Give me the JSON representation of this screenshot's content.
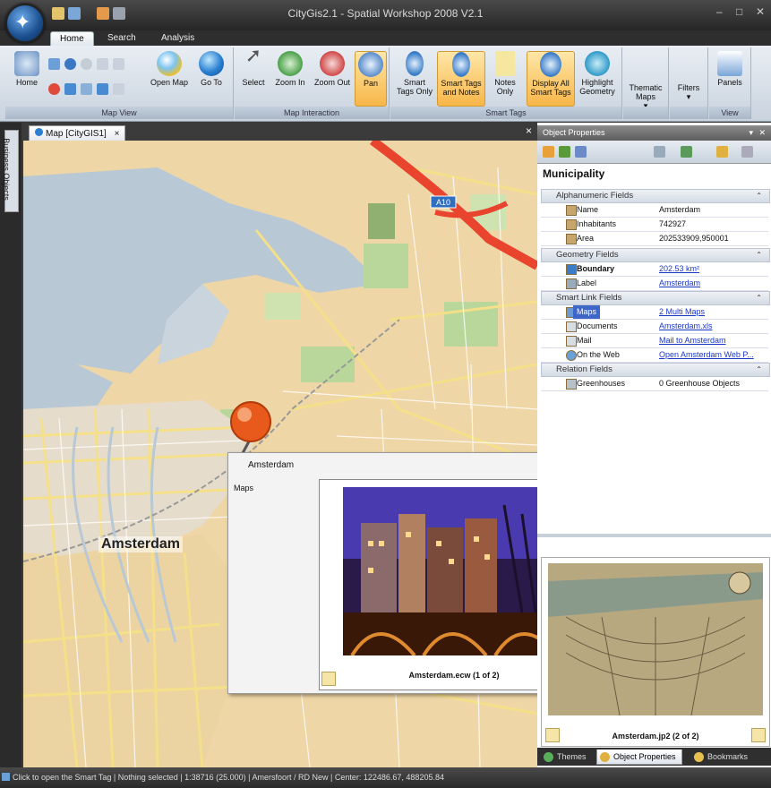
{
  "window": {
    "title": "CityGis2.1 - Spatial Workshop 2008 V2.1",
    "minimize": "–",
    "maximize": "□",
    "close": "✕"
  },
  "ribbon_tabs": [
    "Home",
    "Search",
    "Analysis"
  ],
  "ribbon": {
    "map_view": {
      "label": "Map View",
      "home": "Home",
      "open_map": "Open Map",
      "go_to": "Go To"
    },
    "map_interaction": {
      "label": "Map Interaction",
      "select": "Select",
      "zoom_in": "Zoom In",
      "zoom_out": "Zoom Out",
      "pan": "Pan"
    },
    "smart_tags": {
      "label": "Smart Tags",
      "smart_tags_only": "Smart Tags Only",
      "smart_tags_and_notes": "Smart Tags and Notes",
      "notes_only": "Notes Only",
      "display_all": "Display All Smart Tags",
      "highlight": "Highlight Geometry"
    },
    "thematic_maps": "Thematic Maps",
    "filters": "Filters",
    "view": {
      "label": "View",
      "panels": "Panels"
    }
  },
  "sidebar": {
    "business_objects": "Business Objects"
  },
  "document": {
    "tab_label": "Map [CityGIS1]",
    "close": "×",
    "pane_close": "×"
  },
  "map": {
    "city_label": "Amsterdam",
    "highway_label": "A10"
  },
  "popup": {
    "title": "Amsterdam",
    "maps_label": "Maps",
    "caption": "Amsterdam.ecw (1 of 2)"
  },
  "object_properties": {
    "panel_title": "Object Properties",
    "heading": "Municipality",
    "sections": [
      {
        "title": "Alphanumeric Fields",
        "rows": [
          {
            "key": "Name",
            "value": "Amsterdam",
            "link": false
          },
          {
            "key": "Inhabitants",
            "value": "742927",
            "link": false
          },
          {
            "key": "Area",
            "value": "202533909,950001",
            "link": false
          }
        ]
      },
      {
        "title": "Geometry Fields",
        "rows": [
          {
            "key": "Boundary",
            "value": "202.53 km²",
            "link": true
          },
          {
            "key": "Label",
            "value": "Amsterdam",
            "link": true
          }
        ]
      },
      {
        "title": "Smart Link Fields",
        "rows": [
          {
            "key": "Maps",
            "value": "2 Multi Maps",
            "link": true
          },
          {
            "key": "Documents",
            "value": "Amsterdam.xls",
            "link": true
          },
          {
            "key": "Mail",
            "value": "Mail to Amsterdam",
            "link": true
          },
          {
            "key": "On the Web",
            "value": "Open Amsterdam Web P...",
            "link": true
          }
        ]
      },
      {
        "title": "Relation Fields",
        "rows": [
          {
            "key": "Greenhouses",
            "value": "0 Greenhouse Objects",
            "link": false
          }
        ]
      }
    ],
    "thumbnail_caption": "Amsterdam.jp2 (2 of 2)"
  },
  "bottom_tabs": [
    "Themes",
    "Object Properties",
    "Bookmarks"
  ],
  "status_bar": "Click to open the Smart Tag | Nothing selected | 1:38716 (25.000) | Amersfoort / RD New | Center: 122486.67, 488205.84",
  "colors": {
    "accent": "#f7b648",
    "link": "#1a37c8",
    "map_land": "#efd6a6",
    "map_water": "#b8c8d4",
    "map_green": "#b9d79a",
    "highway": "#e8442e"
  }
}
